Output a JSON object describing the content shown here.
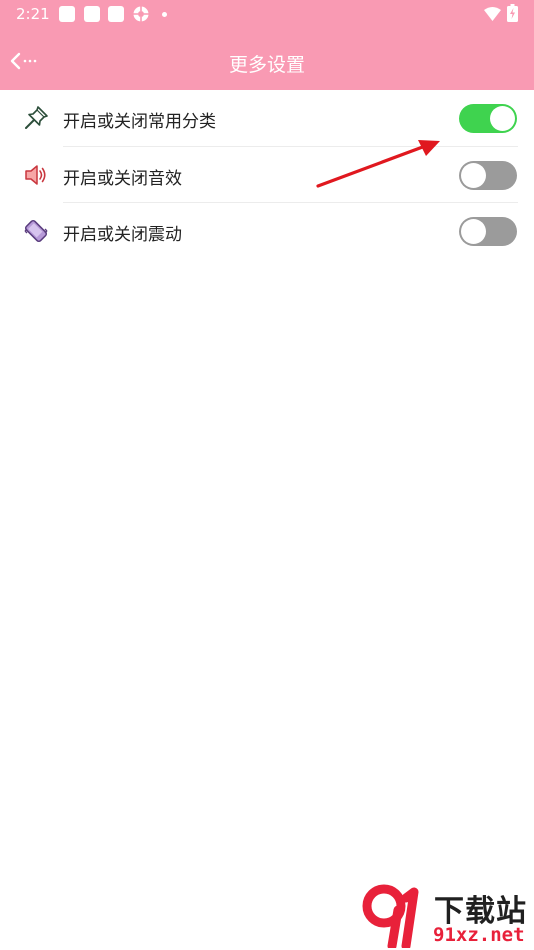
{
  "status_bar": {
    "time": "2:21",
    "notification_icons": [
      "app-notification-icon",
      "app-notification-icon",
      "app-notification-icon",
      "sync-icon"
    ],
    "right_icons": [
      "wifi-icon",
      "battery-icon"
    ]
  },
  "header": {
    "title": "更多设置",
    "back_icon": "back-arrow-icon",
    "background_color": "#f99ab3"
  },
  "settings": [
    {
      "label": "开启或关闭常用分类",
      "icon": "pin-icon",
      "enabled": true
    },
    {
      "label": "开启或关闭音效",
      "icon": "speaker-icon",
      "enabled": false
    },
    {
      "label": "开启或关闭震动",
      "icon": "vibrate-icon",
      "enabled": false
    }
  ],
  "colors": {
    "toggle_on": "#3fd34f",
    "toggle_off": "#9b9b9b",
    "annotation": "#e0181f"
  },
  "watermark": {
    "logo_text": "9f",
    "title": "下载站",
    "domain": "91xz.net"
  }
}
